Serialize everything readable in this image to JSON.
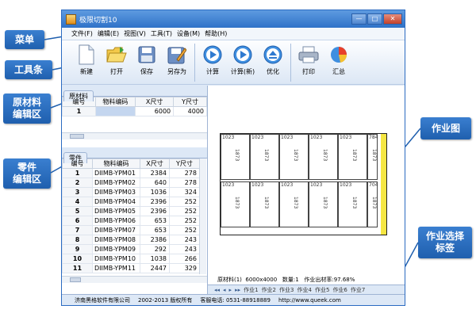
{
  "callouts": {
    "menu": "菜单",
    "toolbar": "工具条",
    "material_line1": "原材料",
    "material_line2": "编辑区",
    "parts_line1": "零件",
    "parts_line2": "编辑区",
    "layout": "作业图",
    "jobtab_line1": "作业选择",
    "jobtab_line2": "标签"
  },
  "window": {
    "title": "极限切割10",
    "buttons": {
      "minimize": "—",
      "maximize": "□",
      "close": "✕"
    }
  },
  "menu": [
    "文件(F)",
    "编辑(E)",
    "视图(V)",
    "工具(T)",
    "设备(M)",
    "帮助(H)"
  ],
  "toolbar": [
    {
      "label": "新建",
      "icon": "new-document-icon"
    },
    {
      "label": "打开",
      "icon": "open-folder-icon"
    },
    {
      "label": "保存",
      "icon": "save-disk-icon"
    },
    {
      "label": "另存为",
      "icon": "save-as-icon"
    },
    {
      "label": "计算",
      "icon": "play-icon"
    },
    {
      "label": "计算(新)",
      "icon": "play-icon"
    },
    {
      "label": "优化",
      "icon": "eject-icon"
    },
    {
      "label": "打印",
      "icon": "printer-icon"
    },
    {
      "label": "汇总",
      "icon": "pie-chart-icon"
    }
  ],
  "material_panel": {
    "tab": "原材料",
    "headers": [
      "编号",
      "物料编码",
      "X尺寸",
      "Y尺寸"
    ],
    "rows": [
      {
        "no": "1",
        "code": "",
        "x": "6000",
        "y": "4000"
      }
    ]
  },
  "parts_panel": {
    "tab": "零件",
    "headers": [
      "编号",
      "物料编码",
      "X尺寸",
      "Y尺寸"
    ],
    "rows": [
      {
        "no": "1",
        "code": "DIIMB-YPM01",
        "x": "2384",
        "y": "278"
      },
      {
        "no": "2",
        "code": "DIIMB-YPM02",
        "x": "640",
        "y": "278"
      },
      {
        "no": "3",
        "code": "DIIMB-YPM03",
        "x": "1036",
        "y": "324"
      },
      {
        "no": "4",
        "code": "DIIMB-YPM04",
        "x": "2396",
        "y": "252"
      },
      {
        "no": "5",
        "code": "DIIMB-YPM05",
        "x": "2396",
        "y": "252"
      },
      {
        "no": "6",
        "code": "DIIMB-YPM06",
        "x": "653",
        "y": "252"
      },
      {
        "no": "7",
        "code": "DIIMB-YPM07",
        "x": "653",
        "y": "252"
      },
      {
        "no": "8",
        "code": "DIIMB-YPM08",
        "x": "2386",
        "y": "243"
      },
      {
        "no": "9",
        "code": "DIIMB-YPM09",
        "x": "292",
        "y": "243"
      },
      {
        "no": "10",
        "code": "DIIMB-YPM10",
        "x": "1038",
        "y": "266"
      },
      {
        "no": "11",
        "code": "DIIMB-YPM11",
        "x": "2447",
        "y": "329"
      }
    ]
  },
  "layout": {
    "pieces_row1": [
      "1023",
      "1023",
      "1023",
      "1023",
      "1023",
      "784"
    ],
    "pieces_row2": [
      "1023",
      "1023",
      "1023",
      "1023",
      "1023",
      "704"
    ],
    "piece_height": "1873",
    "accent_color": "#f5e642"
  },
  "status": {
    "material": "原材料(1)",
    "size": "6000x4000",
    "quantity": "数量:1",
    "yield": "作业出材率:97.68%"
  },
  "job_tabs": {
    "nav": [
      "◂◂",
      "◂",
      "▸",
      "▸▸"
    ],
    "tabs": [
      "作业1",
      "作业2",
      "作业3",
      "作业4",
      "作业5",
      "作业6",
      "作业7"
    ]
  },
  "footer": {
    "company": "济南黑格软件有限公司",
    "copyright": "2002-2013 版权所有",
    "phone": "客服电话: 0531-88918889",
    "url": "http://www.queek.com"
  }
}
